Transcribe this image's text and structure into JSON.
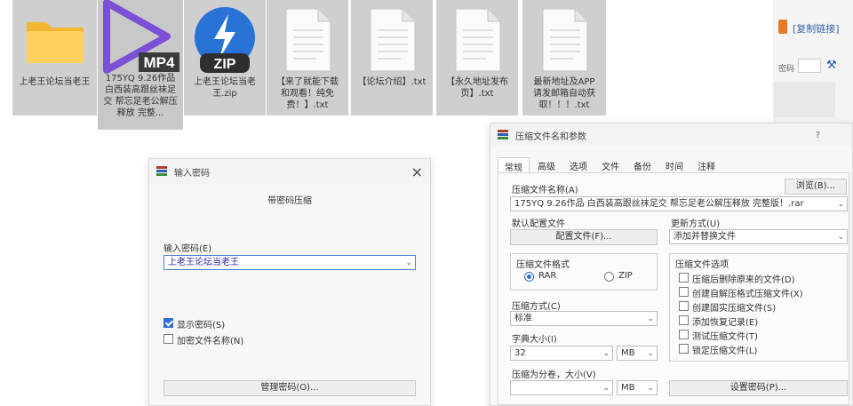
{
  "files": [
    {
      "name": "上老王论坛当老王",
      "icon": "folder-icon"
    },
    {
      "name": "175YQ 9.26作品 白西装高跟丝袜足交 帮忘足老公解压释放 完整...",
      "icon": "mp4-video-icon",
      "badge": "MP4"
    },
    {
      "name": "上老王论坛当老王.zip",
      "icon": "zip-archive-icon",
      "badge": "ZIP"
    },
    {
      "name": "【来了就能下载和观看！纯免费！】.txt",
      "icon": "text-file-icon"
    },
    {
      "name": "【论坛介绍】.txt",
      "icon": "text-file-icon"
    },
    {
      "name": "【永久地址发布页】.txt",
      "icon": "text-file-icon"
    },
    {
      "name": "最新地址及APP请发邮箱自动获取！！！.txt",
      "icon": "text-file-icon"
    }
  ],
  "bg_window": {
    "link_label": "[复制链接]",
    "field_label": "密码"
  },
  "password_dialog": {
    "title": "输入密码",
    "subtitle": "带密码压缩",
    "prompt": "输入密码(E)",
    "password_value": "上老王论坛当老王",
    "show_password": "显示密码(S)",
    "encrypt_names": "加密文件名称(N)",
    "manage_button": "管理密码(O)...",
    "close_glyph": "×"
  },
  "archive_dialog": {
    "title": "压缩文件名和参数",
    "help_glyph": "?",
    "tabs": [
      "常规",
      "高级",
      "选项",
      "文件",
      "备份",
      "时间",
      "注释"
    ],
    "archive_name_label": "压缩文件名称(A)",
    "browse_button": "浏览(B)...",
    "archive_name_value": "175YQ 9.26作品 白西装高跟丝袜足交 帮忘足老公解压释放 完整版！.rar",
    "profile_label": "默认配置文件",
    "profile_button": "配置文件(F)...",
    "update_mode_label": "更新方式(U)",
    "update_mode_value": "添加并替换文件",
    "format_label": "压缩文件格式",
    "format_rar": "RAR",
    "format_zip": "ZIP",
    "method_label": "压缩方式(C)",
    "method_value": "标准",
    "dict_label": "字典大小(I)",
    "dict_value": "32",
    "dict_unit": "MB",
    "split_label": "压缩为分卷，大小(V)",
    "split_value": "",
    "split_unit": "MB",
    "options_label": "压缩文件选项",
    "options": [
      {
        "label": "压缩后删除原来的文件(D)",
        "checked": false
      },
      {
        "label": "创建自解压格式压缩文件(X)",
        "checked": false
      },
      {
        "label": "创建固实压缩文件(S)",
        "checked": false
      },
      {
        "label": "添加恢复记录(E)",
        "checked": false
      },
      {
        "label": "测试压缩文件(T)",
        "checked": false
      },
      {
        "label": "锁定压缩文件(L)",
        "checked": false
      }
    ],
    "set_password_button": "设置密码(P)..."
  }
}
